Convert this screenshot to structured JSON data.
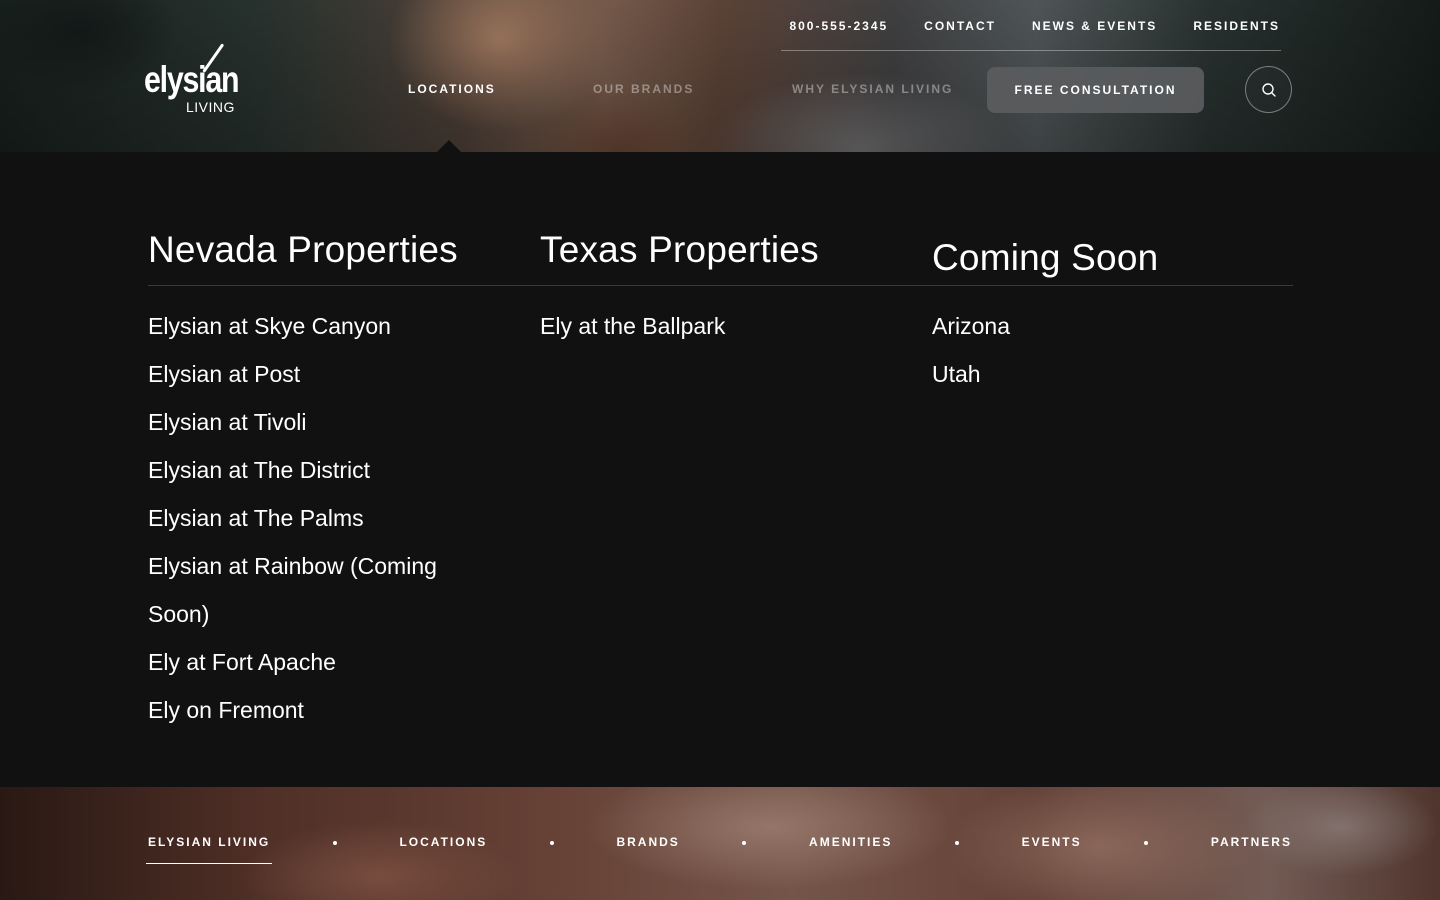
{
  "brand": {
    "logo_text": "elysian",
    "logo_subtext": "LIVING"
  },
  "utility_nav": {
    "phone": "800-555-2345",
    "contact": "CONTACT",
    "news_events": "NEWS & EVENTS",
    "residents": "RESIDENTS"
  },
  "main_nav": {
    "locations": "LOCATIONS",
    "our_brands": "OUR BRANDS",
    "why_elysian": "WHY ELYSIAN LIVING",
    "consultation_button": "FREE CONSULTATION",
    "active_item": "LOCATIONS",
    "search_icon": "search-icon"
  },
  "locations_menu": {
    "columns": [
      {
        "title": "Nevada Properties",
        "items": [
          "Elysian at Skye Canyon",
          "Elysian at Post",
          "Elysian at Tivoli",
          "Elysian at The District",
          "Elysian at The Palms",
          "Elysian at Rainbow (Coming Soon)",
          "Ely at Fort Apache",
          "Ely on Fremont"
        ]
      },
      {
        "title": "Texas Properties",
        "items": [
          "Ely at the Ballpark"
        ]
      },
      {
        "title": "Coming Soon",
        "items": [
          "Arizona",
          "Utah"
        ]
      }
    ]
  },
  "footer_nav": {
    "items": [
      "ELYSIAN LIVING",
      "LOCATIONS",
      "BRANDS",
      "AMENITIES",
      "EVENTS",
      "PARTNERS"
    ],
    "active_item": "ELYSIAN LIVING"
  },
  "colors": {
    "panel_background": "#111111",
    "text": "#ffffff",
    "button_background": "#5a5c5e",
    "divider": "#3a3a3a"
  }
}
